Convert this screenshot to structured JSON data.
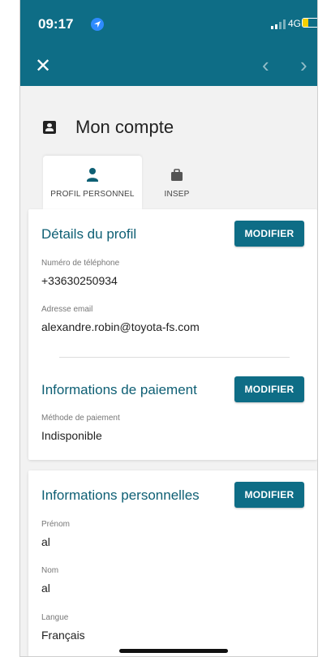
{
  "status": {
    "time": "09:17",
    "network": "4G",
    "battery_fraction": 0.35,
    "colors": {
      "bar": "#0e6d86",
      "battery": "#f5d000"
    }
  },
  "toolbar": {
    "close_icon": "close-icon",
    "prev_icon": "chevron-left-icon",
    "next_icon": "chevron-right-icon"
  },
  "page": {
    "title": "Mon compte",
    "icon": "account-box-icon"
  },
  "tabs": [
    {
      "label": "PROFIL PERSONNEL",
      "icon": "person-icon",
      "active": true
    },
    {
      "label": "INSEP",
      "icon": "briefcase-icon",
      "active": false
    }
  ],
  "profile_details": {
    "title": "Détails du profil",
    "button": "MODIFIER",
    "fields": [
      {
        "label": "Numéro de téléphone",
        "value": "+33630250934"
      },
      {
        "label": "Adresse email",
        "value": "alexandre.robin@toyota-fs.com"
      }
    ]
  },
  "payment": {
    "title": "Informations de paiement",
    "button": "MODIFIER",
    "fields": [
      {
        "label": "Méthode de paiement",
        "value": "Indisponible"
      }
    ]
  },
  "personal": {
    "title": "Informations personnelles",
    "button": "MODIFIER",
    "fields": [
      {
        "label": "Prénom",
        "value": "al"
      },
      {
        "label": "Nom",
        "value": "al"
      },
      {
        "label": "Langue",
        "value": "Français"
      }
    ]
  }
}
